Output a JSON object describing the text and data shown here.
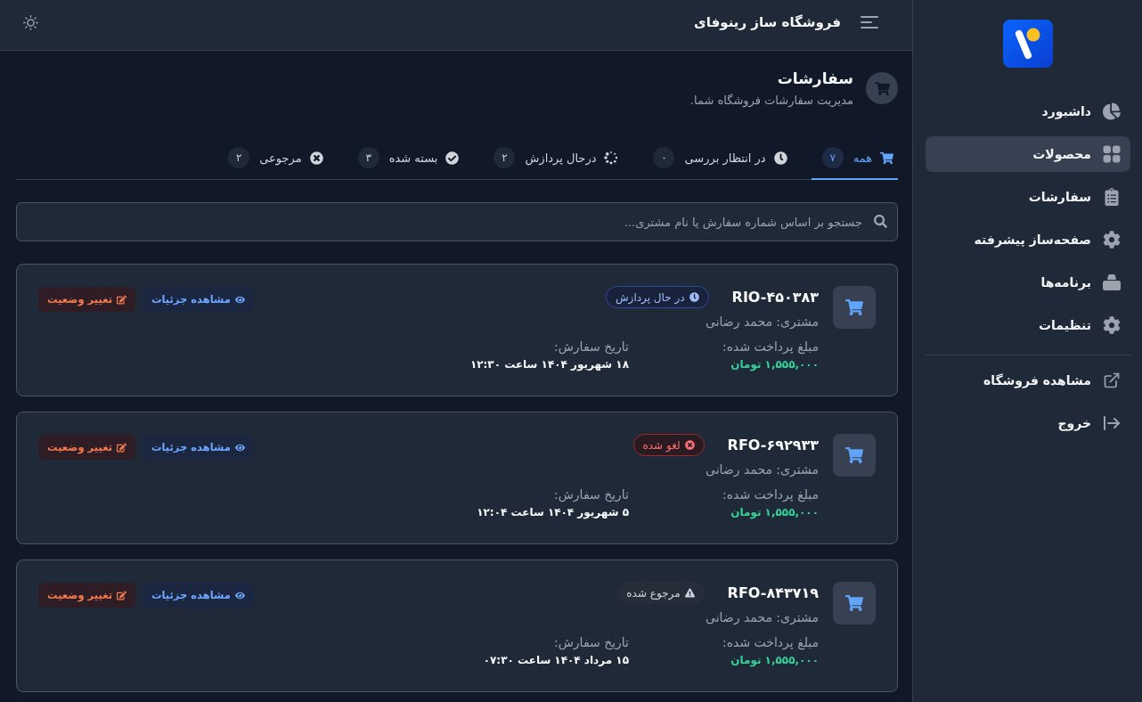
{
  "sidebar": {
    "items": [
      {
        "label": "داشبورد",
        "selected": false
      },
      {
        "label": "محصولات",
        "selected": true
      },
      {
        "label": "سفارشات",
        "selected": false
      },
      {
        "label": "صفحه‌ساز پیشرفته",
        "selected": false
      },
      {
        "label": "برنامه‌ها",
        "selected": false
      },
      {
        "label": "تنظیمات",
        "selected": false
      }
    ],
    "links": [
      {
        "label": "مشاهده فروشگاه"
      },
      {
        "label": "خروج"
      }
    ]
  },
  "header": {
    "title": "فروشگاه ساز رینوفای"
  },
  "page": {
    "title": "سفارشات",
    "subtitle": "مدیریت سفارشات فروشگاه شما."
  },
  "tabs": [
    {
      "label": "همه",
      "count": "۷",
      "selected": true
    },
    {
      "label": "در انتظار بررسی",
      "count": "۰",
      "selected": false
    },
    {
      "label": "درحال پردازش",
      "count": "۲",
      "selected": false
    },
    {
      "label": "بسته شده",
      "count": "۳",
      "selected": false
    },
    {
      "label": "مرجوعی",
      "count": "۲",
      "selected": false
    }
  ],
  "search": {
    "placeholder": "جستجو بر اساس شماره سفارش یا نام مشتری..."
  },
  "orders": [
    {
      "id": "RIO-۴۵۰۳۸۳",
      "status": {
        "kind": "processing",
        "label": "در حال پردازش"
      },
      "customer": "مشتری: محمد رضانی",
      "amount_label": "مبلغ پرداخت شده:",
      "amount": "۱,۵۵۵,۰۰۰ تومان",
      "date_label": "تاریخ سفارش:",
      "date": "۱۸ شهریور ۱۴۰۴ ساعت ۱۲:۳۰",
      "actions": [
        {
          "kind": "view",
          "label": "مشاهده جزئیات"
        },
        {
          "kind": "edit",
          "label": "تغییر وضعیت"
        }
      ]
    },
    {
      "id": "RFO-۶۹۲۹۳۳",
      "status": {
        "kind": "cancelled",
        "label": "لغو شده"
      },
      "customer": "مشتری: محمد رضانی",
      "amount_label": "مبلغ پرداخت شده:",
      "amount": "۱,۵۵۵,۰۰۰ تومان",
      "date_label": "تاریخ سفارش:",
      "date": "۵ شهریور ۱۴۰۴ ساعت ۱۲:۰۴",
      "actions": [
        {
          "kind": "view",
          "label": "مشاهده جزئیات"
        },
        {
          "kind": "edit",
          "label": "تغییر وضعیت"
        }
      ]
    },
    {
      "id": "RFO-۸۴۳۷۱۹",
      "status": {
        "kind": "returned",
        "label": "مرجوع شده"
      },
      "customer": "مشتری: محمد رضانی",
      "amount_label": "مبلغ پرداخت شده:",
      "amount": "۱,۵۵۵,۰۰۰ تومان",
      "date_label": "تاریخ سفارش:",
      "date": "۱۵ مرداد ۱۴۰۴ ساعت ۰۷:۳۰",
      "actions": [
        {
          "kind": "view",
          "label": "مشاهده جزئیات"
        },
        {
          "kind": "edit",
          "label": "تغییر وضعیت"
        }
      ]
    }
  ]
}
